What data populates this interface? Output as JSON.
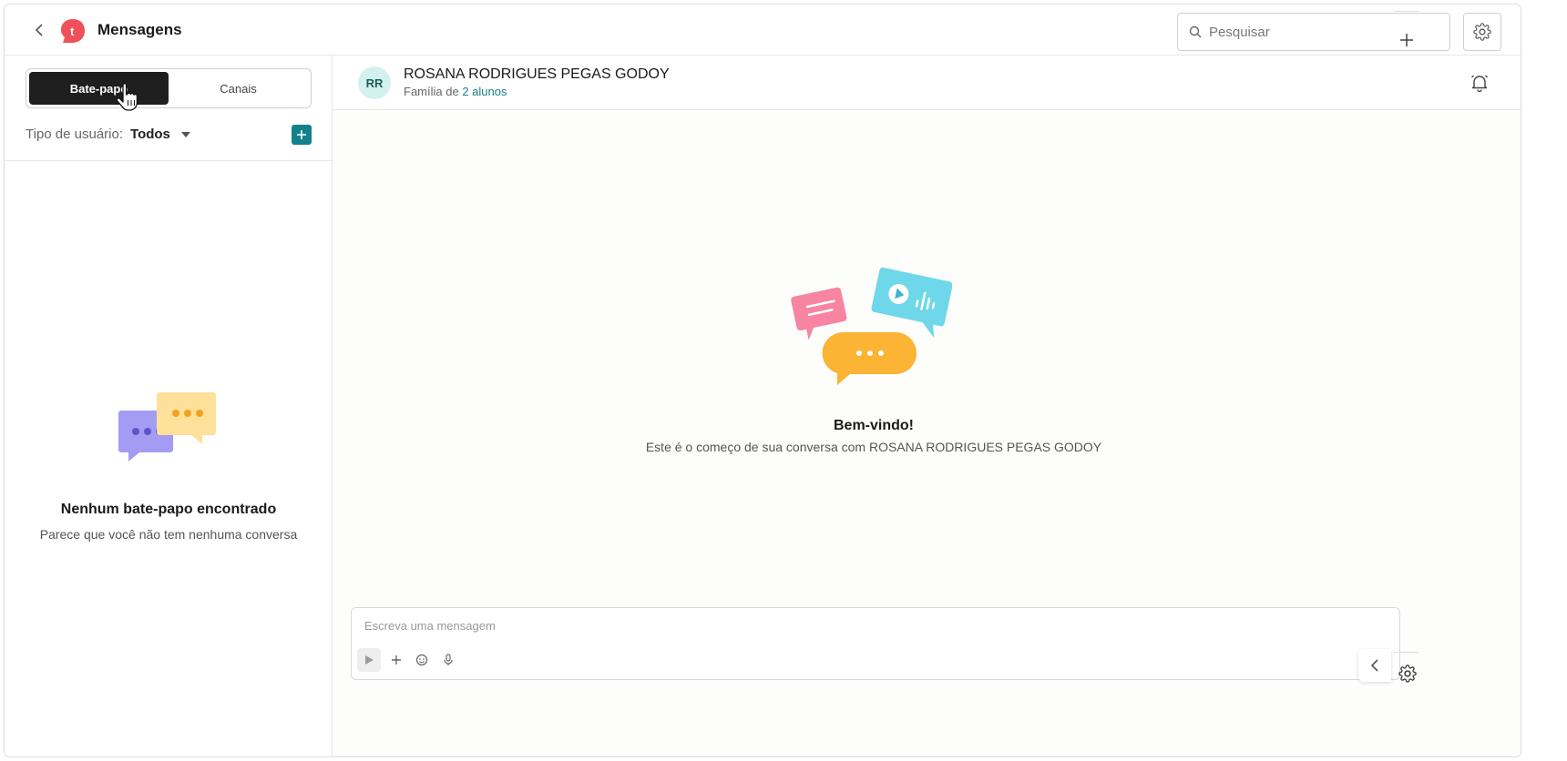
{
  "header": {
    "title": "Mensagens",
    "logo_letter": "t",
    "search_placeholder": "Pesquisar"
  },
  "sidebar": {
    "tabs": [
      {
        "label": "Bate-papo",
        "active": true
      },
      {
        "label": "Canais",
        "active": false
      }
    ],
    "filter_label": "Tipo de usuário:",
    "filter_value": "Todos",
    "empty_title": "Nenhum bate-papo encontrado",
    "empty_subtitle": "Parece que você não tem nenhuma conversa"
  },
  "chat": {
    "avatar_initials": "RR",
    "contact_name": "ROSANA RODRIGUES PEGAS GODOY",
    "contact_sub_prefix": "Família de",
    "contact_sub_link": "2 alunos",
    "welcome_title": "Bem-vindo!",
    "welcome_subtitle": "Este é o começo de sua conversa com ROSANA RODRIGUES PEGAS GODOY",
    "composer_placeholder": "Escreva uma mensagem"
  },
  "colors": {
    "accent": "#13818d",
    "brand": "#f0505a",
    "active_tab": "#1f1f1f",
    "avatar_bg": "#d3f1ee",
    "bubble_purple": "#a49cf3",
    "bubble_yellow": "#fde09a",
    "bubble_pink": "#f784a0",
    "bubble_blue": "#6fd7ea",
    "bubble_orange": "#fbb433"
  },
  "icons": [
    "chevron-left-icon",
    "logo-icon",
    "search-icon",
    "gear-icon",
    "plus-icon",
    "hand-cursor-icon",
    "bell-icon",
    "send-icon",
    "emoji-icon",
    "mic-icon",
    "chevron-left-icon"
  ]
}
